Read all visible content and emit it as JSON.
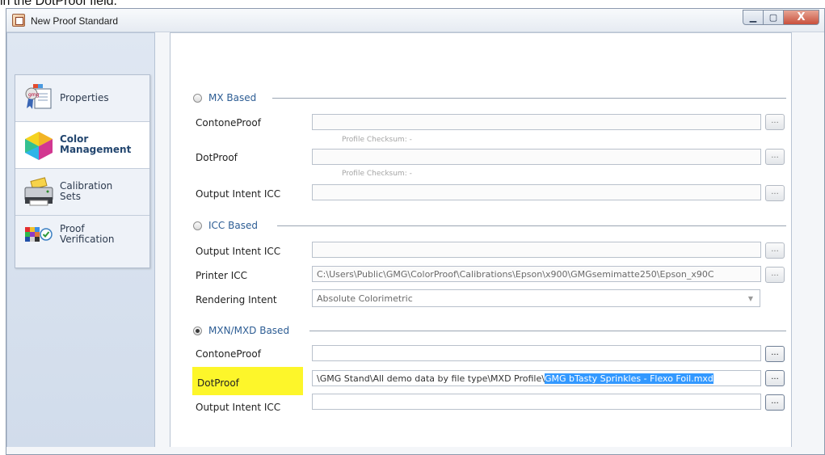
{
  "caption": "in the DotProof field.",
  "window": {
    "title": "New Proof Standard",
    "buttons": {
      "minimize": "▁",
      "maximize": "▢",
      "close": "X"
    }
  },
  "nav": {
    "items": [
      {
        "label_line1": "Properties",
        "label_line2": "",
        "icon": "certificate-icon",
        "active": false
      },
      {
        "label_line1": "Color",
        "label_line2": "Management",
        "icon": "color-cube-icon",
        "active": true
      },
      {
        "label_line1": "Calibration",
        "label_line2": "Sets",
        "icon": "printer-icon",
        "active": false
      },
      {
        "label_line1": "Proof",
        "label_line2": "Verification",
        "icon": "color-check-icon",
        "active": false
      }
    ]
  },
  "mx": {
    "title": "MX Based",
    "contone_label": "ContoneProof",
    "contone_value": "",
    "checksum1": "Profile Checksum: -",
    "dot_label": "DotProof",
    "dot_value": "",
    "checksum2": "Profile Checksum: -",
    "output_label": "Output Intent ICC",
    "output_value": ""
  },
  "icc": {
    "title": "ICC Based",
    "output_label": "Output Intent ICC",
    "output_value": "",
    "printer_label": "Printer ICC",
    "printer_value": "C:\\Users\\Public\\GMG\\ColorProof\\Calibrations\\Epson\\x900\\GMGsemimatte250\\Epson_x90C",
    "rendering_label": "Rendering Intent",
    "rendering_value": "Absolute Colorimetric"
  },
  "mxn": {
    "title": "MXN/MXD Based",
    "contone_label": "ContoneProof",
    "contone_value": "",
    "dot_label": "DotProof",
    "dot_value_prefix": "\\GMG Stand\\All demo data by file type\\MXD Profile\\",
    "dot_value_selected": "GMG bTasty Sprinkles - Flexo Foil.mxd",
    "output_label": "Output Intent ICC",
    "output_value": ""
  },
  "browse_label": "...",
  "colors": {
    "highlight": "#fdf62a",
    "selection": "#3399ff",
    "section": "#2d5d94"
  }
}
